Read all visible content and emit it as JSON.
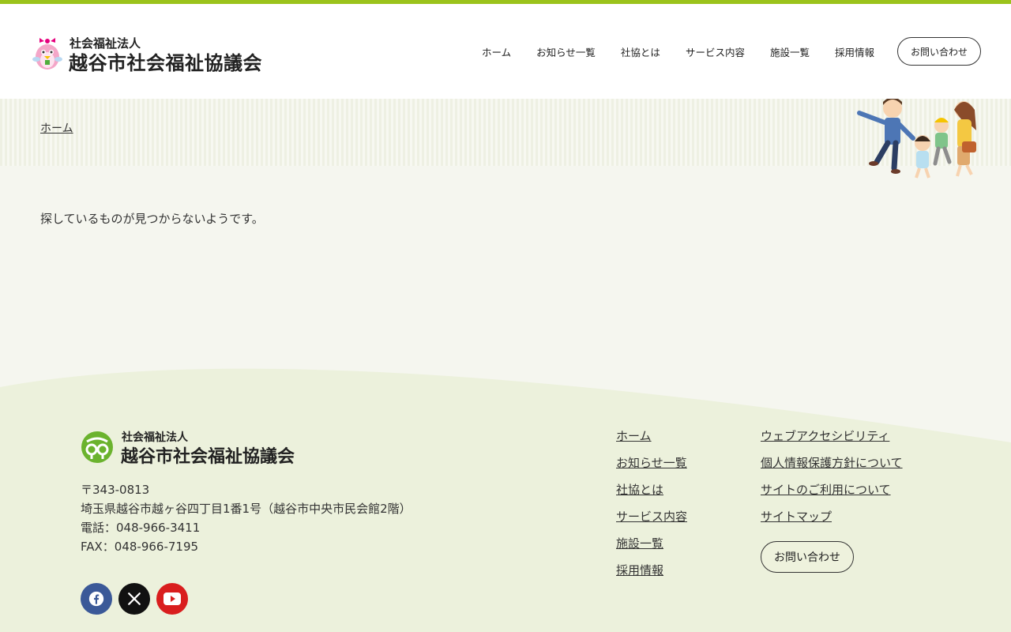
{
  "header": {
    "org_type": "社会福祉法人",
    "org_name": "越谷市社会福祉協議会",
    "nav": [
      {
        "label": "ホーム"
      },
      {
        "label": "お知らせ一覧"
      },
      {
        "label": "社協とは"
      },
      {
        "label": "サービス内容"
      },
      {
        "label": "施設一覧"
      },
      {
        "label": "採用情報"
      }
    ],
    "contact_label": "お問い合わせ"
  },
  "breadcrumb": {
    "home": "ホーム"
  },
  "main": {
    "message": "探しているものが見つからないようです。"
  },
  "footer": {
    "org_type": "社会福祉法人",
    "org_name": "越谷市社会福祉協議会",
    "postal": "〒343-0813",
    "address": "埼玉県越谷市越ヶ谷四丁目1番1号（越谷市中央市民会館2階）",
    "phone": "電話：048-966-3411",
    "fax": "FAX：048-966-7195",
    "social_icons": [
      "facebook-icon",
      "x-icon",
      "youtube-icon"
    ],
    "nav_col1": [
      {
        "label": "ホーム"
      },
      {
        "label": "お知らせ一覧"
      },
      {
        "label": "社協とは"
      },
      {
        "label": "サービス内容"
      },
      {
        "label": "施設一覧"
      },
      {
        "label": "採用情報"
      }
    ],
    "nav_col2": [
      {
        "label": "ウェブアクセシビリティ"
      },
      {
        "label": "個人情報保護方針について"
      },
      {
        "label": "サイトのご利用について"
      },
      {
        "label": "サイトマップ"
      }
    ],
    "contact_label": "お問い合わせ"
  },
  "colors": {
    "accent": "#9bc31c",
    "footer_bg": "#ecf1dc",
    "page_bg": "#f5f6ef"
  }
}
